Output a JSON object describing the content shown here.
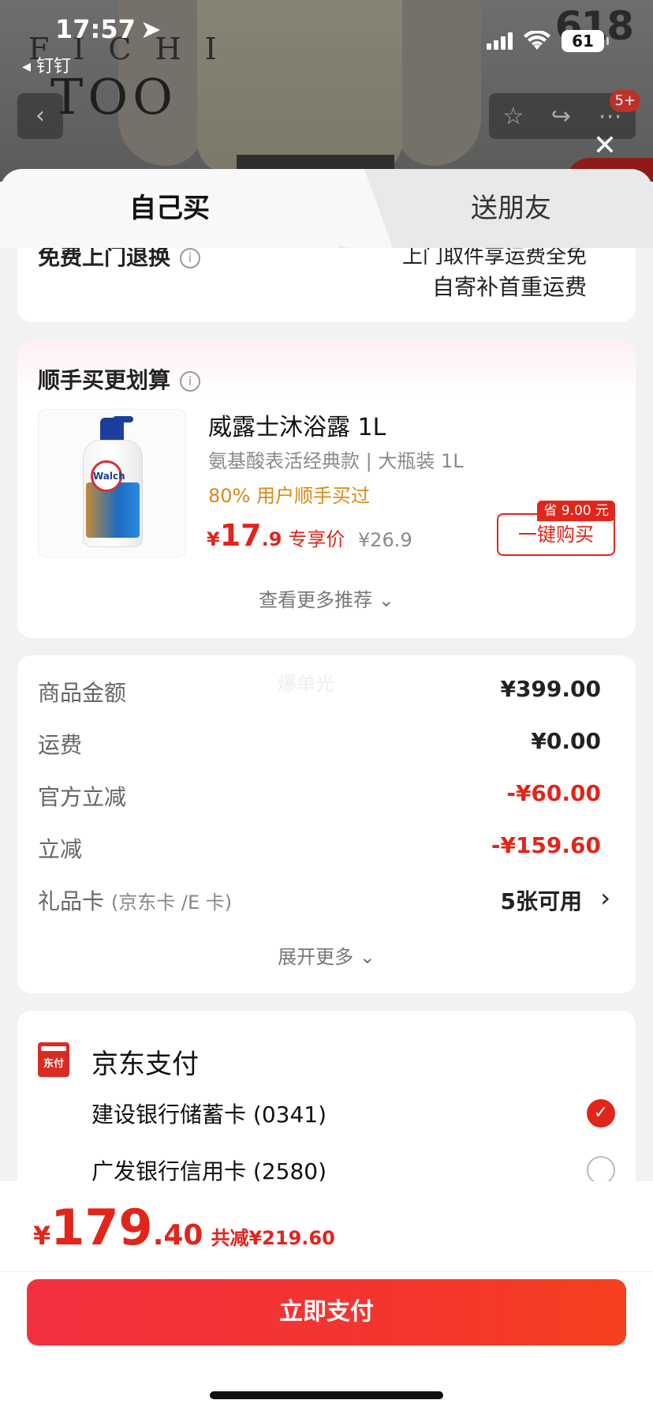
{
  "status_bar": {
    "time": "17:57",
    "back_app": "◂ 钉钉",
    "battery": "61"
  },
  "hero": {
    "brand_line1": "FICHI",
    "brand_line2": "TOO",
    "promo": "618",
    "message_count": "5+"
  },
  "tabs": {
    "self": "自己买",
    "friend": "送朋友"
  },
  "return_service": {
    "label": "免费上门退换",
    "line1": "上门取件享运费全免",
    "line2": "自寄补首重运费"
  },
  "recommend": {
    "title": "顺手买更划算",
    "product": {
      "name": "威露士沐浴露 1L",
      "spec": "氨基酸表活经典款 | 大瓶装 1L",
      "stat": "80% 用户顺手买过",
      "price_symbol": "¥",
      "price_int": "17",
      "price_dec": ".9",
      "price_tag": "专享价",
      "original_price": "¥26.9",
      "save_badge": "省 9.00 元",
      "buy_label": "一键购买",
      "logo_text": "Walch"
    },
    "more_label": "查看更多推荐 ⌄"
  },
  "amounts": {
    "watermark": "爆单光",
    "rows": [
      {
        "label": "商品金额",
        "value": "¥399.00"
      },
      {
        "label": "运费",
        "value": "¥0.00"
      },
      {
        "label": "官方立减",
        "value": "-¥60.00"
      },
      {
        "label": "立减",
        "value": "-¥159.60"
      },
      {
        "label": "礼品卡",
        "label_note": "(京东卡 /E 卡)",
        "value": "5张可用"
      }
    ],
    "expand_label": "展开更多 ⌄",
    "accent_color": "#e1251b"
  },
  "payment": {
    "logo_text": "东付",
    "title": "京东支付",
    "options": [
      {
        "label": "建设银行储蓄卡 (0341)",
        "selected": true
      },
      {
        "label": "广发银行信用卡 (2580)",
        "selected": false
      }
    ]
  },
  "bottom": {
    "total_symbol": "¥",
    "total_int": "179",
    "total_dec": ".40",
    "total_reduce": "共减¥219.60",
    "pay_label": "立即支付"
  }
}
